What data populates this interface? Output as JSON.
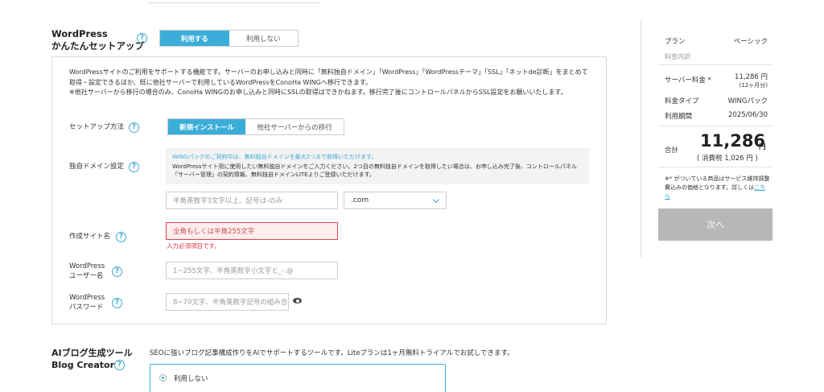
{
  "wp_setup": {
    "title_line1": "WordPress",
    "title_line2": "かんたんセットアップ",
    "toggle_use": "利用する",
    "toggle_not_use": "利用しない",
    "description": "WordPressサイトのご利用をサポートする機能です。サーバーのお申し込みと同時に「無料独自ドメイン」「WordPress」「WordPressテーマ」「SSL」「ネットde診断」をまとめて取得・設定できるほか、既に他社サーバーで利用しているWordPressをConoHa WINGへ移行できます。",
    "description_note": "※他社サーバーから移行の場合のみ、ConoHa WINGのお申し込みと同時にSSLの取得はできかねます。移行完了後にコントロールパネルからSSL設定をお願いいたします。",
    "setup_method_label": "セットアップ方法",
    "setup_new": "新規インストール",
    "setup_migrate": "他社サーバーからの移行",
    "domain_label": "独自ドメイン設定",
    "domain_notice_blue": "WINGパックのご契約中は、無料独自ドメインを最大2つまで取得いただけます。",
    "domain_notice_text": "WordPressサイト用に使用したい無料独自ドメインをご入力ください。2つ目の無料独自ドメインを取得したい場合は、お申し込み完了後、コントロールパネル「サーバー管理」の契約情報、無料独自ドメインLITEよりご登録いただけます。",
    "domain_placeholder": "半角英数字3文字以上、記号は-のみ",
    "domain_tld": ".com",
    "site_name_label": "作成サイト名",
    "site_name_placeholder": "全角もしくは半角255文字",
    "site_name_error": "入力必須項目です。",
    "username_label_line1": "WordPress",
    "username_label_line2": "ユーザー名",
    "username_placeholder": "1~255文字、半角英数字小文字と_-.@",
    "password_label_line1": "WordPress",
    "password_label_line2": "パスワード",
    "password_placeholder": "8~70文字、半角英数字記号の組み合"
  },
  "ai_blog": {
    "title_line1": "AIブログ生成ツール",
    "title_line2": "Blog Creator",
    "description": "SEOに強いブログ記事構成作りをAIでサポートするツールです。Liteプランは1ヶ月無料トライアルでお試しできます。",
    "option_not_use": "利用しない"
  },
  "summary": {
    "plan_label": "プラン",
    "plan_value": "ベーシック",
    "breakdown_label": "料金内訳",
    "server_fee_label": "サーバー料金 *",
    "server_fee_value": "11,286 円",
    "server_fee_period": "(12ヶ月分)",
    "fee_type_label": "料金タイプ",
    "fee_type_value": "WINGパック",
    "period_label": "利用期間",
    "period_value": "2025/06/30",
    "total_label": "合計",
    "total_value": "11,286",
    "total_unit": "円",
    "tax_text": "( 消費税 1,026 円 )",
    "note_text": "※* がついている商品はサービス維持調整費込みの価格となります。詳しくは",
    "note_link": "こちら",
    "next_button": "次へ"
  },
  "colors": {
    "accent": "#3aaed8",
    "error": "#e0454f",
    "disabled_button": "#b7b7b7"
  }
}
